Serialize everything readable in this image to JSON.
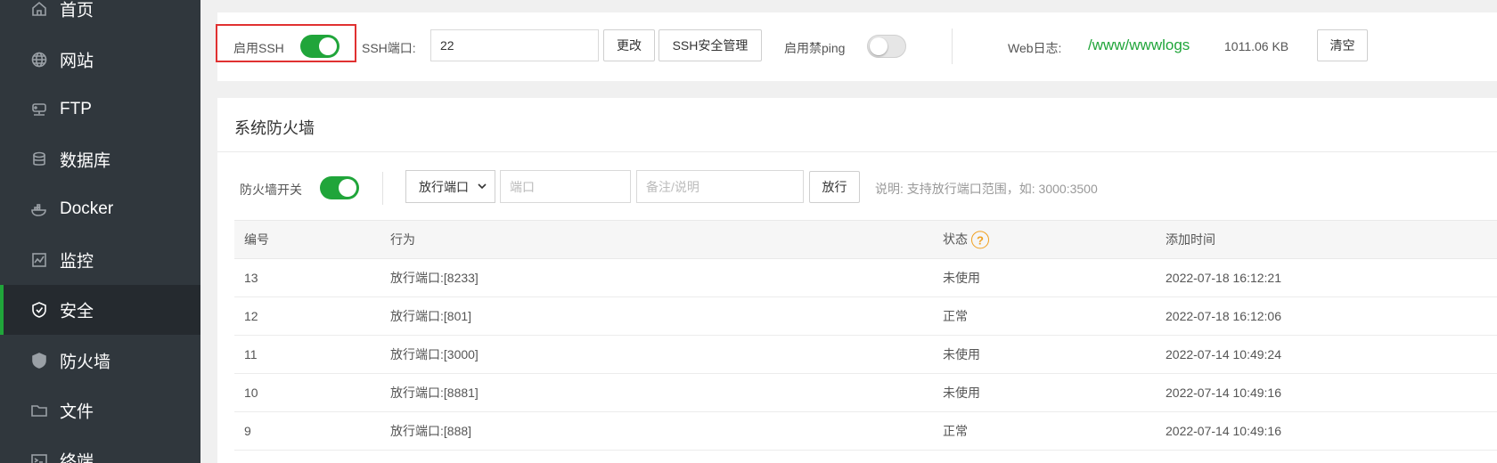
{
  "sidebar": {
    "items": [
      {
        "label": "首页",
        "icon": "home-icon"
      },
      {
        "label": "网站",
        "icon": "globe-icon"
      },
      {
        "label": "FTP",
        "icon": "ftp-icon"
      },
      {
        "label": "数据库",
        "icon": "database-icon"
      },
      {
        "label": "Docker",
        "icon": "docker-icon"
      },
      {
        "label": "监控",
        "icon": "monitor-icon"
      },
      {
        "label": "安全",
        "icon": "shield-check-icon"
      },
      {
        "label": "防火墙",
        "icon": "shield-icon"
      },
      {
        "label": "文件",
        "icon": "folder-icon"
      },
      {
        "label": "终端",
        "icon": "terminal-icon"
      }
    ],
    "active": "安全"
  },
  "ssh": {
    "enable_label": "启用SSH",
    "enable_on": true,
    "port_label": "SSH端口:",
    "port_value": "22",
    "change_button": "更改",
    "manage_button": "SSH安全管理",
    "ping_label": "启用禁ping",
    "ping_on": false,
    "log_label": "Web日志:",
    "log_path": "/www/wwwlogs",
    "log_size": "1011.06 KB",
    "clear_button": "清空"
  },
  "firewall": {
    "title": "系统防火墙",
    "switch_label": "防火墙开关",
    "switch_on": true,
    "select_value": "放行端口",
    "port_placeholder": "端口",
    "remark_placeholder": "备注/说明",
    "allow_button": "放行",
    "note": "说明: 支持放行端口范围，如: 3000:3500",
    "columns": [
      "编号",
      "行为",
      "状态",
      "添加时间"
    ],
    "help_glyph": "?",
    "rows": [
      {
        "id": "13",
        "action": "放行端口:[8233]",
        "status": "未使用",
        "time": "2022-07-18 16:12:21"
      },
      {
        "id": "12",
        "action": "放行端口:[801]",
        "status": "正常",
        "time": "2022-07-18 16:12:06"
      },
      {
        "id": "11",
        "action": "放行端口:[3000]",
        "status": "未使用",
        "time": "2022-07-14 10:49:24"
      },
      {
        "id": "10",
        "action": "放行端口:[8881]",
        "status": "未使用",
        "time": "2022-07-14 10:49:16"
      },
      {
        "id": "9",
        "action": "放行端口:[888]",
        "status": "正常",
        "time": "2022-07-14 10:49:16"
      }
    ]
  },
  "colors": {
    "accent": "#20a53a",
    "sidebar": "#30373d",
    "highlight": "#e03131",
    "help": "#f0a020"
  }
}
